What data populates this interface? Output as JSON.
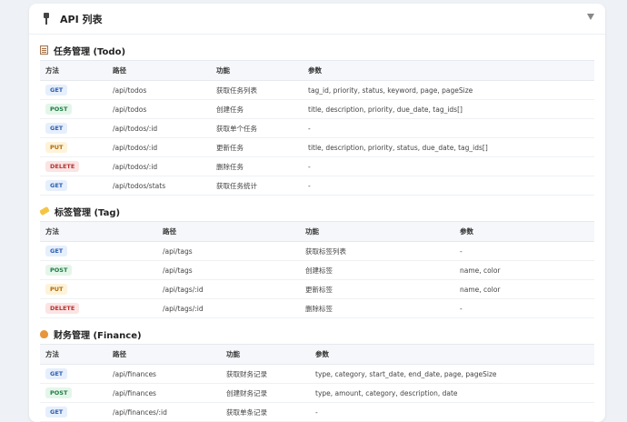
{
  "header": {
    "title": "API 列表"
  },
  "columns": {
    "method": "方法",
    "path": "路径",
    "function": "功能",
    "params": "参数"
  },
  "sections": [
    {
      "title": "任务管理 (Todo)",
      "rows": [
        {
          "method": "GET",
          "path": "/api/todos",
          "function": "获取任务列表",
          "params": "tag_id, priority, status, keyword, page, pageSize"
        },
        {
          "method": "POST",
          "path": "/api/todos",
          "function": "创建任务",
          "params": "title, description, priority, due_date, tag_ids[]"
        },
        {
          "method": "GET",
          "path": "/api/todos/:id",
          "function": "获取单个任务",
          "params": "-"
        },
        {
          "method": "PUT",
          "path": "/api/todos/:id",
          "function": "更新任务",
          "params": "title, description, priority, status, due_date, tag_ids[]"
        },
        {
          "method": "DELETE",
          "path": "/api/todos/:id",
          "function": "删除任务",
          "params": "-"
        },
        {
          "method": "GET",
          "path": "/api/todos/stats",
          "function": "获取任务统计",
          "params": "-"
        }
      ]
    },
    {
      "title": "标签管理 (Tag)",
      "rows": [
        {
          "method": "GET",
          "path": "/api/tags",
          "function": "获取标签列表",
          "params": "-"
        },
        {
          "method": "POST",
          "path": "/api/tags",
          "function": "创建标签",
          "params": "name, color"
        },
        {
          "method": "PUT",
          "path": "/api/tags/:id",
          "function": "更新标签",
          "params": "name, color"
        },
        {
          "method": "DELETE",
          "path": "/api/tags/:id",
          "function": "删除标签",
          "params": "-"
        }
      ]
    },
    {
      "title": "财务管理 (Finance)",
      "rows": [
        {
          "method": "GET",
          "path": "/api/finances",
          "function": "获取财务记录",
          "params": "type, category, start_date, end_date, page, pageSize"
        },
        {
          "method": "POST",
          "path": "/api/finances",
          "function": "创建财务记录",
          "params": "type, amount, category, description, date"
        },
        {
          "method": "GET",
          "path": "/api/finances/:id",
          "function": "获取单条记录",
          "params": "-"
        }
      ]
    }
  ]
}
